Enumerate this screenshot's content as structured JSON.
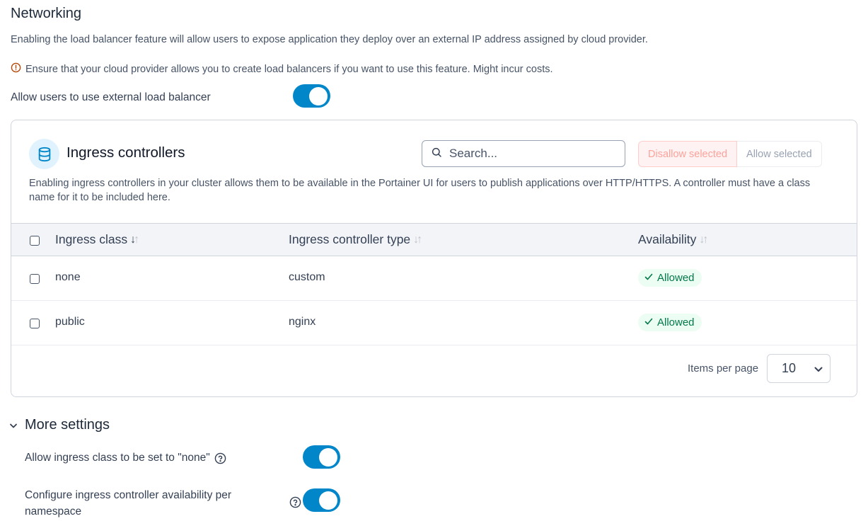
{
  "networking": {
    "title": "Networking",
    "description": "Enabling the load balancer feature will allow users to expose application they deploy over an external IP address assigned by cloud provider.",
    "warning": "Ensure that your cloud provider allows you to create load balancers if you want to use this feature. Might incur costs.",
    "load_balancer_label": "Allow users to use external load balancer",
    "load_balancer_enabled": true
  },
  "ingress": {
    "title": "Ingress controllers",
    "search_placeholder": "Search...",
    "disallow_label": "Disallow selected",
    "allow_label": "Allow selected",
    "description": "Enabling ingress controllers in your cluster allows them to be available in the Portainer UI for users to publish applications over HTTP/HTTPS. A controller must have a class name for it to be included here.",
    "columns": [
      "Ingress class",
      "Ingress controller type",
      "Availability"
    ],
    "rows": [
      {
        "class": "none",
        "type": "custom",
        "availability": "Allowed"
      },
      {
        "class": "public",
        "type": "nginx",
        "availability": "Allowed"
      }
    ],
    "items_per_page_label": "Items per page",
    "items_per_page": "10"
  },
  "more_settings": {
    "title": "More settings",
    "allow_none_label": "Allow ingress class to be set to \"none\"",
    "allow_none_enabled": true,
    "per_namespace_label_line1": "Configure ingress controller availability per",
    "per_namespace_label_line2": "namespace",
    "per_namespace_enabled": true
  },
  "colors": {
    "toggle_on": "#0086c9",
    "badge_text": "#027a48",
    "badge_bg": "#ecfdf3",
    "warning_icon": "#b54708"
  }
}
